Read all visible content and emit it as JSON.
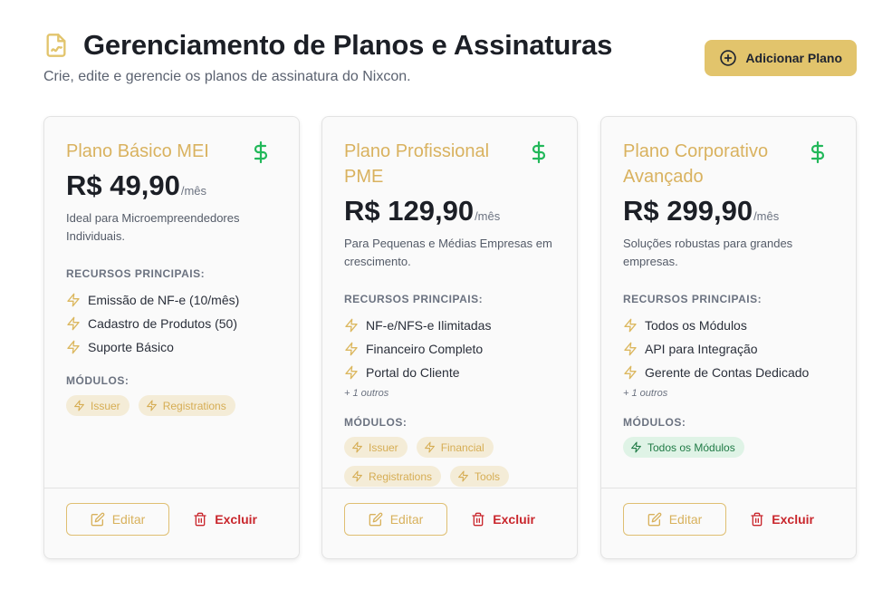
{
  "header": {
    "title": "Gerenciamento de Planos e Assinaturas",
    "subtitle": "Crie, edite e gerencie os planos de assinatura do Nixcon.",
    "add_button_label": "Adicionar Plano"
  },
  "labels": {
    "features_heading": "RECURSOS PRINCIPAIS:",
    "modules_heading": "MÓDULOS:",
    "edit": "Editar",
    "delete": "Excluir"
  },
  "plans": [
    {
      "name": "Plano Básico MEI",
      "price": "R$ 49,90",
      "period": "/mês",
      "description": "Ideal para Microempreendedores Individuais.",
      "features": [
        "Emissão de NF-e (10/mês)",
        "Cadastro de Produtos (50)",
        "Suporte Básico"
      ],
      "more": "",
      "modules": [
        "Issuer",
        "Registrations"
      ]
    },
    {
      "name": "Plano Profissional PME",
      "price": "R$ 129,90",
      "period": "/mês",
      "description": "Para Pequenas e Médias Empresas em crescimento.",
      "features": [
        "NF-e/NFS-e Ilimitadas",
        "Financeiro Completo",
        "Portal do Cliente"
      ],
      "more": "+ 1 outros",
      "modules": [
        "Issuer",
        "Financial",
        "Registrations",
        "Tools"
      ]
    },
    {
      "name": "Plano Corporativo Avançado",
      "price": "R$ 299,90",
      "period": "/mês",
      "description": "Soluções robustas para grandes empresas.",
      "features": [
        "Todos os Módulos",
        "API para Integração",
        "Gerente de Contas Dedicado"
      ],
      "more": "+ 1 outros",
      "modules": [
        "Todos os Módulos"
      ]
    }
  ],
  "colors": {
    "accent": "#e2c46c",
    "plan_name": "#d9b25f",
    "dollar": "#22b85a",
    "delete": "#c9272d",
    "chip_green_bg": "#dff3e6"
  },
  "icons": {
    "title": "file-signature-icon",
    "add": "plus-circle-icon",
    "price": "dollar-sign-icon",
    "feature": "zap-icon",
    "edit": "edit-icon",
    "delete": "trash-icon"
  }
}
